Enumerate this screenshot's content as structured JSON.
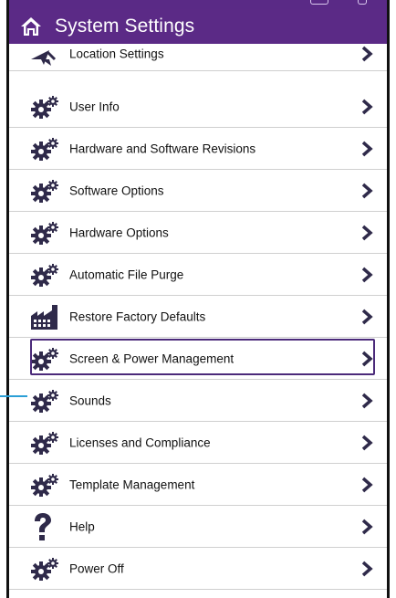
{
  "header": {
    "title": "System Settings",
    "home_icon": "home-icon",
    "accent_color": "#5b2a86"
  },
  "menu": {
    "items": [
      {
        "label": "Location Settings",
        "icon": "location-arrow-icon"
      },
      {
        "label": "User Info",
        "icon": "gears-icon"
      },
      {
        "label": "Hardware and Software Revisions",
        "icon": "gears-icon"
      },
      {
        "label": "Software Options",
        "icon": "gears-icon"
      },
      {
        "label": "Hardware Options",
        "icon": "gears-icon"
      },
      {
        "label": "Automatic File Purge",
        "icon": "gears-icon"
      },
      {
        "label": "Restore Factory Defaults",
        "icon": "factory-icon"
      },
      {
        "label": "Screen & Power Management",
        "icon": "gears-icon",
        "selected": true
      },
      {
        "label": "Sounds",
        "icon": "gears-icon"
      },
      {
        "label": "Licenses and Compliance",
        "icon": "gears-icon"
      },
      {
        "label": "Template Management",
        "icon": "gears-icon"
      },
      {
        "label": "Help",
        "icon": "question-mark-icon"
      },
      {
        "label": "Power Off",
        "icon": "gears-icon"
      }
    ]
  }
}
